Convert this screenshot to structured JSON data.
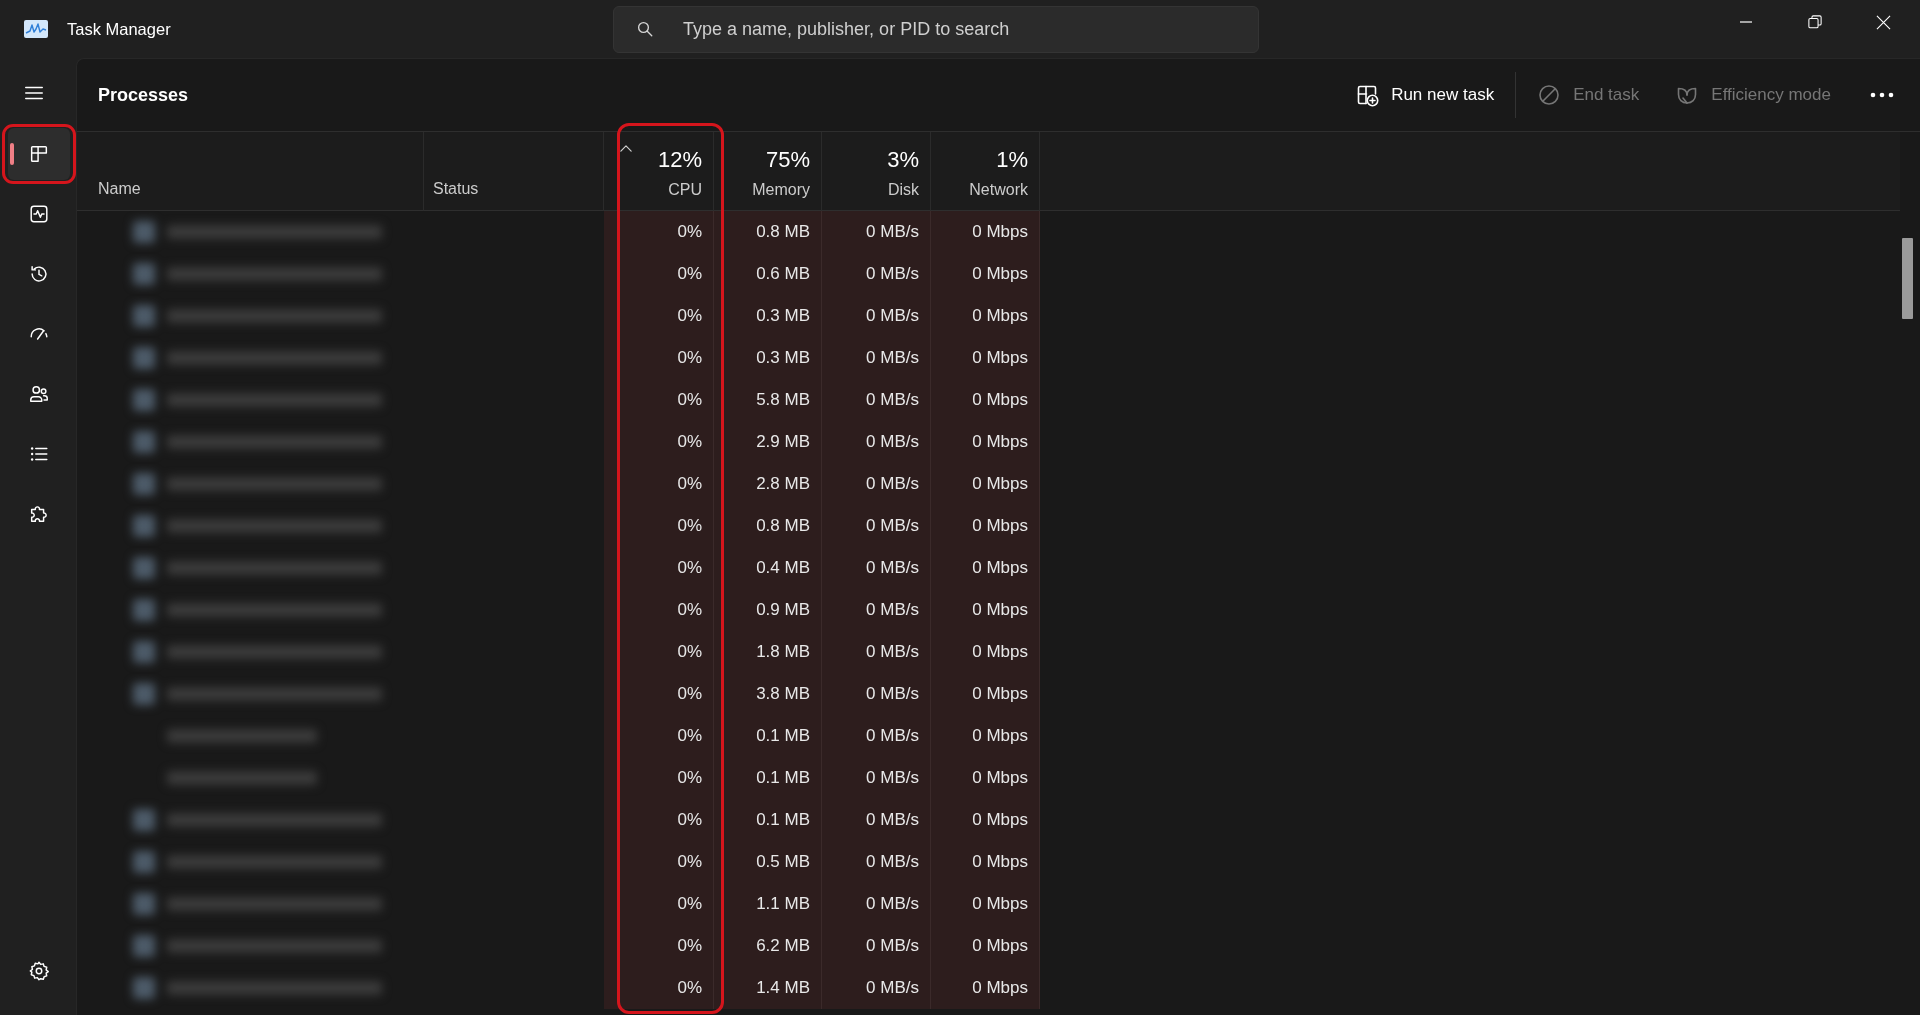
{
  "window": {
    "title": "Task Manager"
  },
  "search": {
    "placeholder": "Type a name, publisher, or PID to search"
  },
  "sidebar": {
    "items": [
      {
        "kind": "processes",
        "selected": true,
        "highlighted": true
      },
      {
        "kind": "performance",
        "selected": false,
        "highlighted": false
      },
      {
        "kind": "app_history",
        "selected": false,
        "highlighted": false
      },
      {
        "kind": "startup_apps",
        "selected": false,
        "highlighted": false
      },
      {
        "kind": "users",
        "selected": false,
        "highlighted": false
      },
      {
        "kind": "details",
        "selected": false,
        "highlighted": false
      },
      {
        "kind": "services",
        "selected": false,
        "highlighted": false
      }
    ],
    "footer_items": [
      {
        "kind": "settings",
        "selected": false,
        "highlighted": false
      }
    ]
  },
  "page": {
    "title": "Processes",
    "actions": [
      {
        "kind": "run_task",
        "label": "Run new task",
        "disabled": false
      },
      {
        "kind": "end_task",
        "label": "End task",
        "disabled": true
      },
      {
        "kind": "efficiency",
        "label": "Efficiency mode",
        "disabled": true
      }
    ]
  },
  "table": {
    "columns": [
      {
        "label": "Name",
        "sorted": false,
        "highlighted": false
      },
      {
        "label": "Status",
        "sorted": false,
        "highlighted": false
      },
      {
        "label": "CPU",
        "usage": "12%",
        "sorted": true,
        "highlighted": true
      },
      {
        "label": "Memory",
        "usage": "75%",
        "sorted": false,
        "highlighted": false
      },
      {
        "label": "Disk",
        "usage": "3%",
        "sorted": false,
        "highlighted": false
      },
      {
        "label": "Network",
        "usage": "1%",
        "sorted": false,
        "highlighted": false
      }
    ],
    "rows": [
      {
        "values": [
          "0%",
          "0.8 MB",
          "0 MB/s",
          "0 Mbps"
        ]
      },
      {
        "values": [
          "0%",
          "0.6 MB",
          "0 MB/s",
          "0 Mbps"
        ]
      },
      {
        "values": [
          "0%",
          "0.3 MB",
          "0 MB/s",
          "0 Mbps"
        ]
      },
      {
        "values": [
          "0%",
          "0.3 MB",
          "0 MB/s",
          "0 Mbps"
        ]
      },
      {
        "values": [
          "0%",
          "5.8 MB",
          "0 MB/s",
          "0 Mbps"
        ]
      },
      {
        "values": [
          "0%",
          "2.9 MB",
          "0 MB/s",
          "0 Mbps"
        ]
      },
      {
        "values": [
          "0%",
          "2.8 MB",
          "0 MB/s",
          "0 Mbps"
        ]
      },
      {
        "values": [
          "0%",
          "0.8 MB",
          "0 MB/s",
          "0 Mbps"
        ]
      },
      {
        "values": [
          "0%",
          "0.4 MB",
          "0 MB/s",
          "0 Mbps"
        ]
      },
      {
        "values": [
          "0%",
          "0.9 MB",
          "0 MB/s",
          "0 Mbps"
        ]
      },
      {
        "values": [
          "0%",
          "1.8 MB",
          "0 MB/s",
          "0 Mbps"
        ]
      },
      {
        "values": [
          "0%",
          "3.8 MB",
          "0 MB/s",
          "0 Mbps"
        ],
        "children": [
          {
            "values": [
              "0%",
              "0.1 MB",
              "0 MB/s",
              "0 Mbps"
            ]
          },
          {
            "values": [
              "0%",
              "0.1 MB",
              "0 MB/s",
              "0 Mbps"
            ]
          }
        ]
      },
      {
        "values": [
          "0%",
          "0.1 MB",
          "0 MB/s",
          "0 Mbps"
        ]
      },
      {
        "values": [
          "0%",
          "0.5 MB",
          "0 MB/s",
          "0 Mbps"
        ]
      },
      {
        "values": [
          "0%",
          "1.1 MB",
          "0 MB/s",
          "0 Mbps"
        ]
      },
      {
        "values": [
          "0%",
          "6.2 MB",
          "0 MB/s",
          "0 Mbps"
        ]
      },
      {
        "values": [
          "0%",
          "1.4 MB",
          "0 MB/s",
          "0 Mbps"
        ]
      }
    ]
  }
}
